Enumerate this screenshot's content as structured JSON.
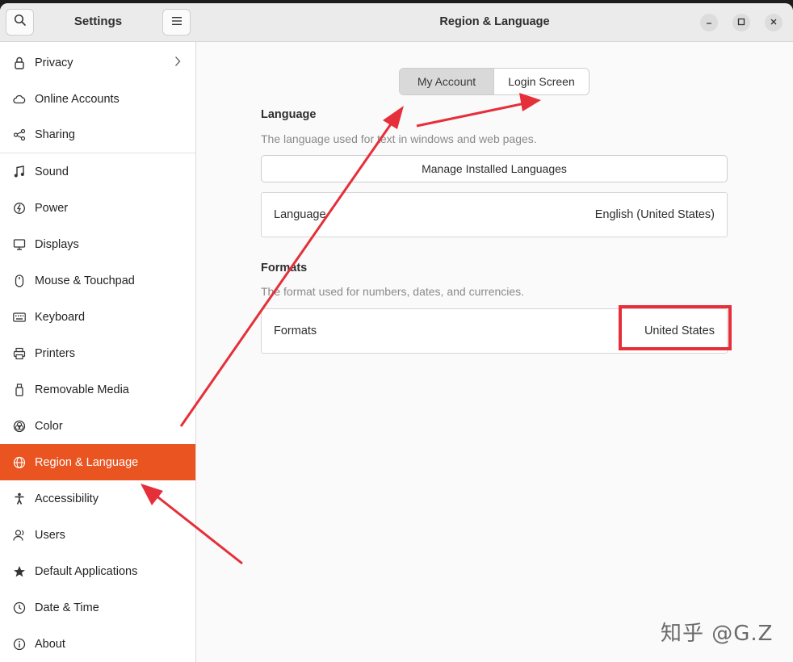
{
  "sidebar": {
    "title": "Settings",
    "search_icon": "search-icon",
    "menu_icon": "hamburger-menu-icon",
    "items": [
      {
        "label": "Privacy",
        "icon": "lock-icon"
      },
      {
        "label": "Online Accounts",
        "icon": "cloud-icon"
      },
      {
        "label": "Sharing",
        "icon": "share-icon"
      },
      {
        "label": "Sound",
        "icon": "music-note-icon"
      },
      {
        "label": "Power",
        "icon": "power-icon"
      },
      {
        "label": "Displays",
        "icon": "display-icon"
      },
      {
        "label": "Mouse & Touchpad",
        "icon": "mouse-icon"
      },
      {
        "label": "Keyboard",
        "icon": "keyboard-icon"
      },
      {
        "label": "Printers",
        "icon": "printer-icon"
      },
      {
        "label": "Removable Media",
        "icon": "usb-drive-icon"
      },
      {
        "label": "Color",
        "icon": "color-icon"
      },
      {
        "label": "Region & Language",
        "icon": "globe-icon",
        "active": true
      },
      {
        "label": "Accessibility",
        "icon": "accessibility-icon"
      },
      {
        "label": "Users",
        "icon": "users-icon"
      },
      {
        "label": "Default Applications",
        "icon": "star-icon"
      },
      {
        "label": "Date & Time",
        "icon": "clock-icon"
      },
      {
        "label": "About",
        "icon": "info-icon"
      }
    ]
  },
  "header": {
    "title": "Region & Language"
  },
  "tabs": {
    "my_account": "My Account",
    "login_screen": "Login Screen",
    "selected": "My Account"
  },
  "language_section": {
    "title": "Language",
    "description": "The language used for text in windows and web pages.",
    "manage_button": "Manage Installed Languages",
    "row_label": "Language",
    "row_value": "English (United States)"
  },
  "formats_section": {
    "title": "Formats",
    "description": "The format used for numbers, dates, and currencies.",
    "row_label": "Formats",
    "row_value": "United States"
  },
  "watermark": "知乎 @G.Z",
  "colors": {
    "accent": "#e95420",
    "annotation": "#e52f39"
  }
}
